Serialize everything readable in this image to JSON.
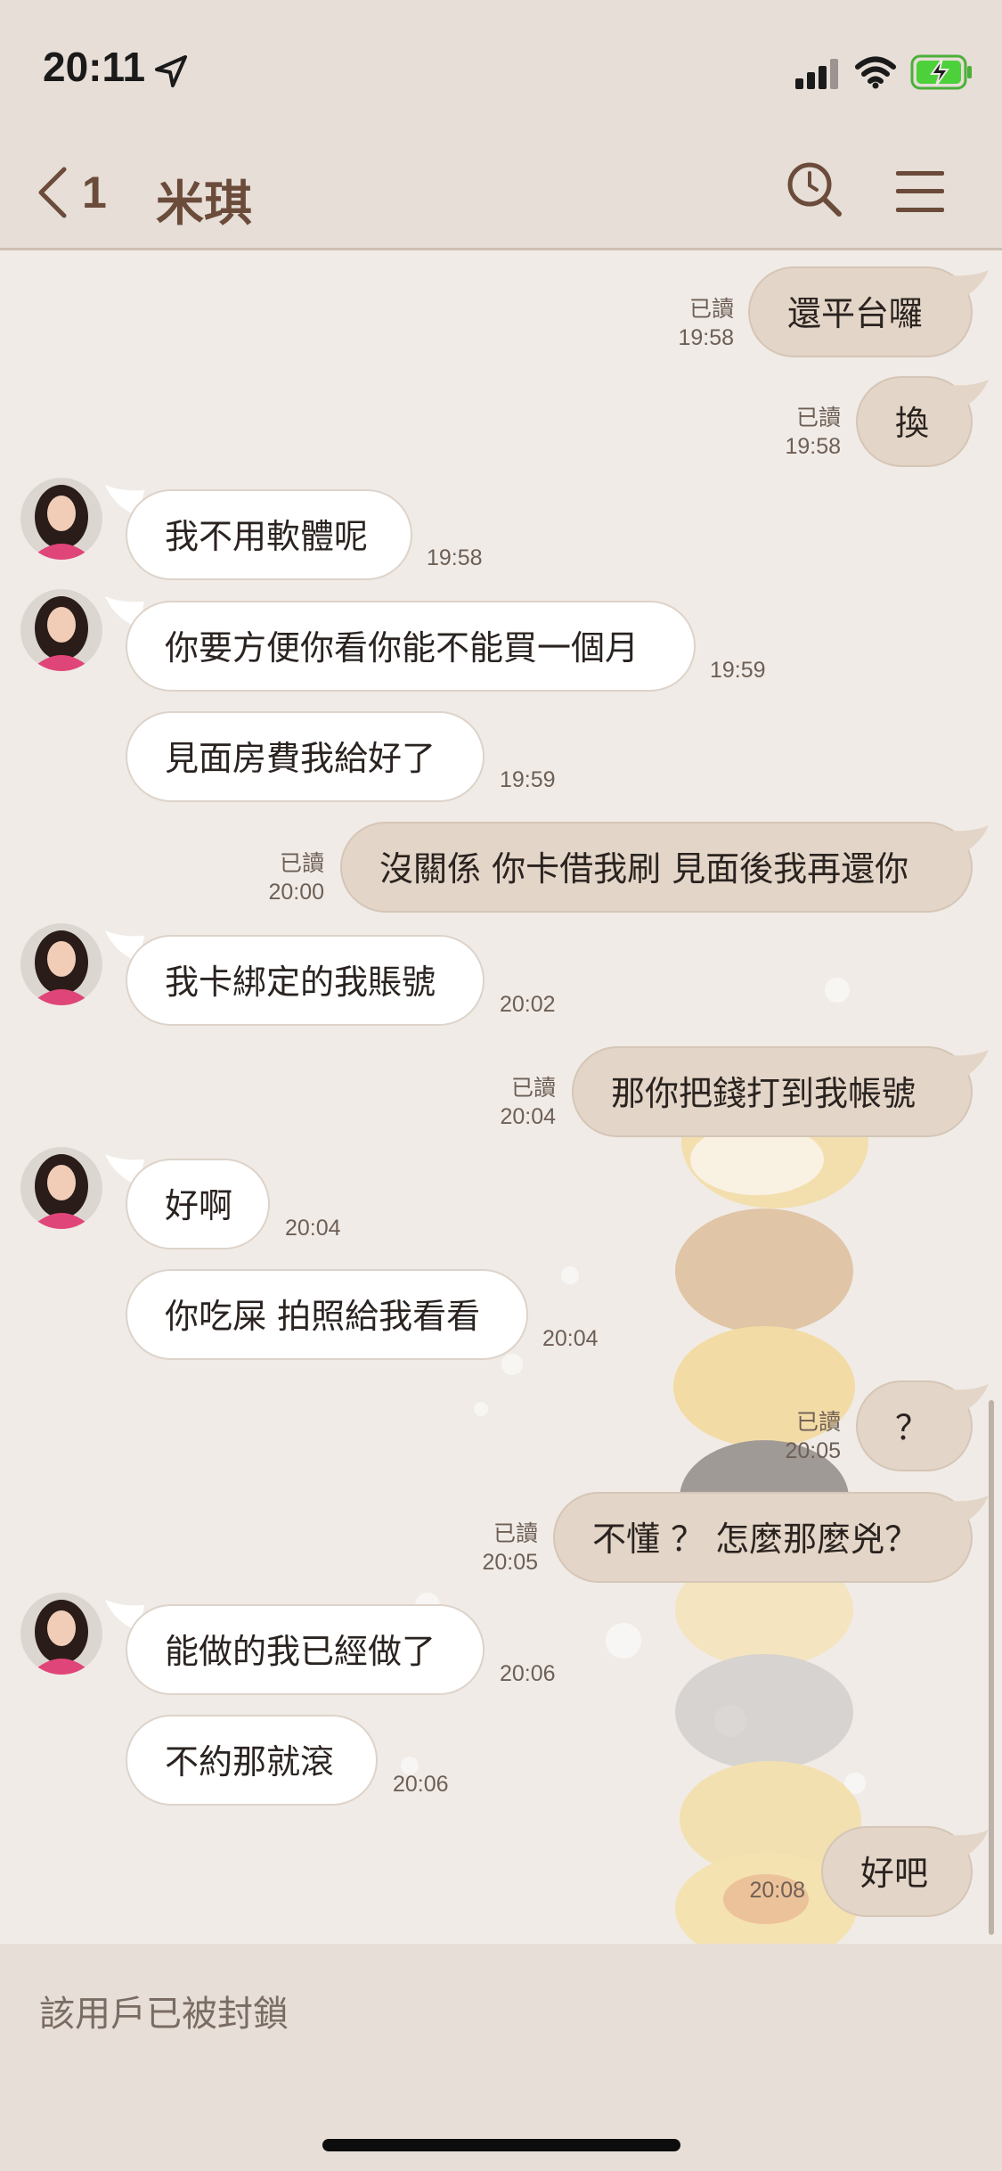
{
  "status": {
    "time": "20:11"
  },
  "header": {
    "back_count": "1",
    "title": "米琪"
  },
  "messages": [
    {
      "side": "out",
      "text": "還平台囉",
      "read": "已讀",
      "time": "19:58"
    },
    {
      "side": "out",
      "text": "換",
      "read": "已讀",
      "time": "19:58"
    },
    {
      "side": "in",
      "text": "我不用軟體呢",
      "time": "19:58"
    },
    {
      "side": "in",
      "text": "你要方便你看你能不能買一個月",
      "time": "19:59"
    },
    {
      "side": "in",
      "text": "見面房費我給好了",
      "time": "19:59"
    },
    {
      "side": "out",
      "text": "沒關係 你卡借我刷 見面後我再還你",
      "read": "已讀",
      "time": "20:00"
    },
    {
      "side": "in",
      "text": "我卡綁定的我賬號",
      "time": "20:02"
    },
    {
      "side": "out",
      "text": "那你把錢打到我帳號",
      "read": "已讀",
      "time": "20:04"
    },
    {
      "side": "in",
      "text": "好啊",
      "time": "20:04"
    },
    {
      "side": "in",
      "text": "你吃屎 拍照給我看看",
      "time": "20:04"
    },
    {
      "side": "out",
      "text": "？",
      "read": "已讀",
      "time": "20:05"
    },
    {
      "side": "out",
      "text": "不懂 ？ 怎麼那麼兇？",
      "read": "已讀",
      "time": "20:05"
    },
    {
      "side": "in",
      "text": "能做的我已經做了",
      "time": "20:06"
    },
    {
      "side": "in",
      "text": "不約那就滾",
      "time": "20:06"
    },
    {
      "side": "out",
      "text": "好吧",
      "time": "20:08"
    }
  ],
  "footer": {
    "blocked_notice": "該用戶已被封鎖"
  },
  "colors": {
    "bubble_out": "#e3d5c7",
    "bubble_in": "#ffffff",
    "header_bg": "#e6ded7",
    "accent": "#6b4b3a"
  },
  "icons": [
    "location-arrow-icon",
    "signal-icon",
    "wifi-icon",
    "battery-charging-icon",
    "back-chevron-icon",
    "search-icon",
    "menu-icon",
    "avatar"
  ]
}
